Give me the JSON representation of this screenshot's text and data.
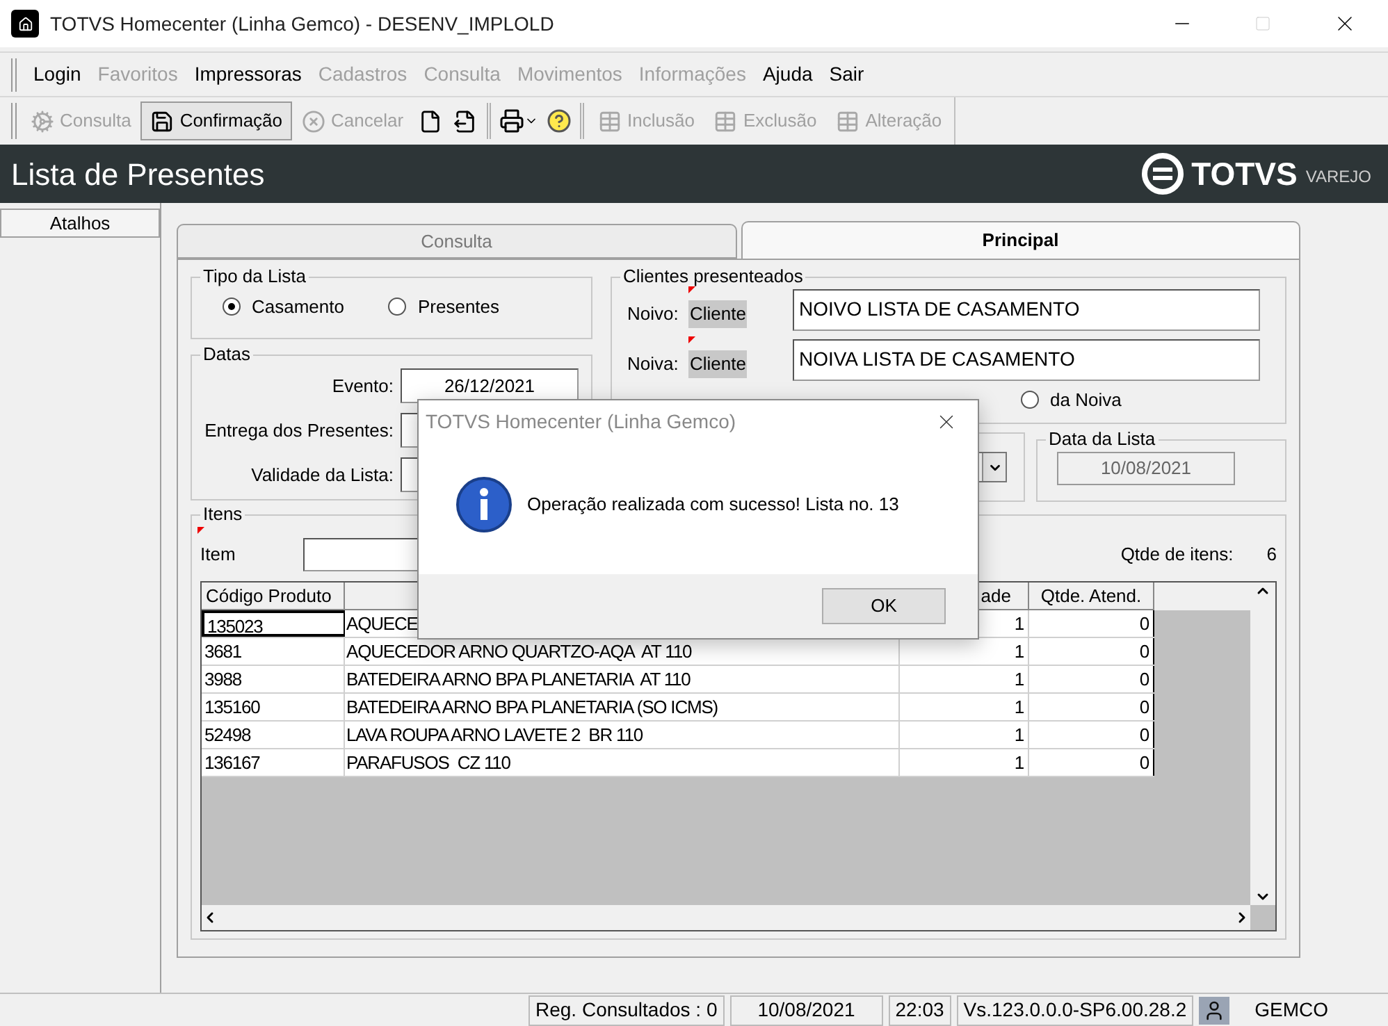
{
  "window": {
    "title": "TOTVS Homecenter (Linha Gemco) - DESENV_IMPLOLD"
  },
  "menu": [
    {
      "label": "Login",
      "disabled": false
    },
    {
      "label": "Favoritos",
      "disabled": true
    },
    {
      "label": "Impressoras",
      "disabled": false
    },
    {
      "label": "Cadastros",
      "disabled": true
    },
    {
      "label": "Consulta",
      "disabled": true
    },
    {
      "label": "Movimentos",
      "disabled": true
    },
    {
      "label": "Informações",
      "disabled": true
    },
    {
      "label": "Ajuda",
      "disabled": false
    },
    {
      "label": "Sair",
      "disabled": false
    }
  ],
  "toolbar": {
    "left": [
      {
        "label": "Consulta",
        "disabled": true,
        "selected": false
      },
      {
        "label": "Confirmação",
        "disabled": false,
        "selected": true
      },
      {
        "label": "Cancelar",
        "disabled": true,
        "selected": false
      }
    ],
    "right": [
      {
        "label": "Inclusão",
        "disabled": true,
        "selected": false
      },
      {
        "label": "Exclusão",
        "disabled": true,
        "selected": false
      },
      {
        "label": "Alteração",
        "disabled": true,
        "selected": false
      }
    ]
  },
  "header": {
    "title": "Lista de Presentes",
    "logo": {
      "name": "TOTVS",
      "tagline": "VAREJO"
    }
  },
  "sidebar": {
    "header": "Atalhos"
  },
  "tabs": [
    {
      "label": "Consulta",
      "selected": false
    },
    {
      "label": "Principal",
      "selected": true
    }
  ],
  "tipo_da_lista": {
    "legend": "Tipo da Lista",
    "options": [
      {
        "label": "Casamento",
        "selected": true
      },
      {
        "label": "Presentes",
        "selected": false
      }
    ]
  },
  "datas": {
    "legend": "Datas",
    "fields": [
      {
        "label": "Evento:",
        "value": "26/12/2021"
      },
      {
        "label": "Entrega dos Presentes:"
      },
      {
        "label": "Validade da Lista:"
      }
    ]
  },
  "clientes": {
    "legend": "Clientes presenteados",
    "rows": [
      {
        "label": "Noivo:",
        "tag": "Cliente",
        "value": "NOIVO LISTA DE CASAMENTO"
      },
      {
        "label": "Noiva:",
        "tag": "Cliente",
        "value": "NOIVA LISTA DE CASAMENTO"
      }
    ],
    "endereco": {
      "options": [
        {
          "label": "da Noiva",
          "selected": false
        }
      ]
    }
  },
  "data_da_lista": {
    "legend": "Data da Lista",
    "value": "10/08/2021"
  },
  "itens": {
    "legend": "Itens",
    "item_label": "Item",
    "count_label": "Qtde de itens:",
    "count": "6",
    "columns": {
      "column_1": "Código Produto",
      "column_3": "ade",
      "column_4": "Qtde. Atend."
    },
    "rows": [
      {
        "code": "135023",
        "description": "AQUECE",
        "qty": "1",
        "attended": "0",
        "selected": true
      },
      {
        "code": "3681",
        "description": "AQUECEDOR ARNO QUARTZO-AQA  AT 110",
        "qty": "1",
        "attended": "0",
        "selected": false
      },
      {
        "code": "3988",
        "description": "BATEDEIRA ARNO BPA PLANETARIA  AT 110",
        "qty": "1",
        "attended": "0",
        "selected": false
      },
      {
        "code": "135160",
        "description": "BATEDEIRA ARNO BPA PLANETARIA (SO ICMS)",
        "qty": "1",
        "attended": "0",
        "selected": false
      },
      {
        "code": "52498",
        "description": "LAVA ROUPA ARNO LAVETE 2  BR 110",
        "qty": "1",
        "attended": "0",
        "selected": false
      },
      {
        "code": "136167",
        "description": "PARAFUSOS  CZ 110",
        "qty": "1",
        "attended": "0",
        "selected": false
      }
    ]
  },
  "dialog": {
    "title": "TOTVS Homecenter (Linha Gemco)",
    "message": "Operação realizada com sucesso! Lista no. 13",
    "button": "OK"
  },
  "status_bar": [
    "Reg. Consultados : 0",
    "10/08/2021",
    "22:03",
    "Vs.123.0.0.0-SP6.00.28.2",
    "GEMCO"
  ]
}
